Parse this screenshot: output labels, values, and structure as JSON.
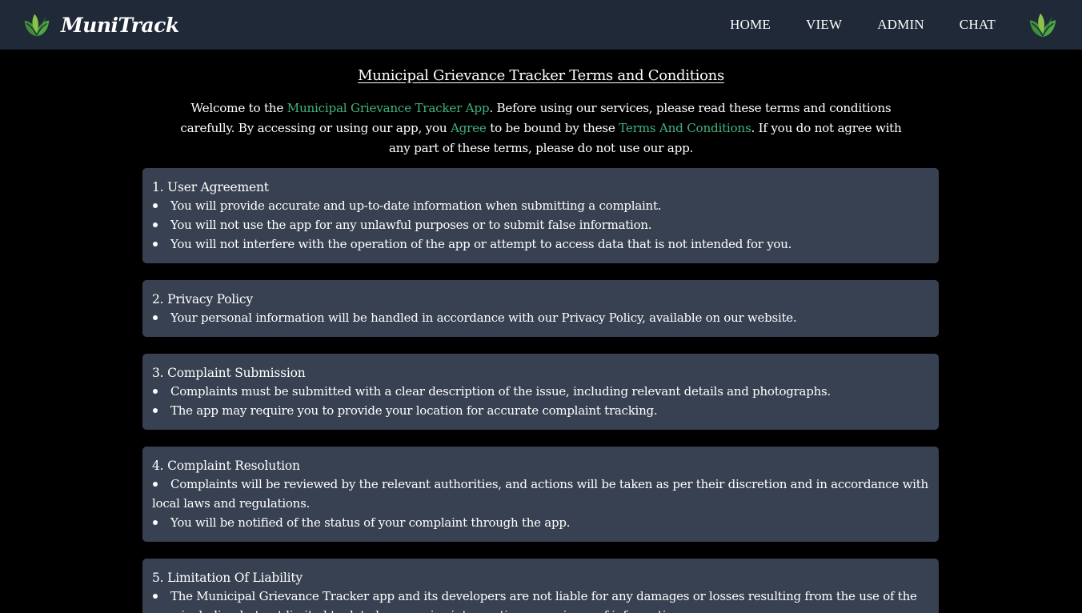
{
  "brand": {
    "name": "MuniTrack"
  },
  "nav": {
    "items": [
      "HOME",
      "VIEW",
      "ADMIN",
      "CHAT"
    ]
  },
  "colors": {
    "navbar_bg": "#1f2937",
    "page_bg": "#000000",
    "card_bg": "#374151",
    "highlight": "#3fb27f"
  },
  "icons": {
    "brand_logo": "leaf-logo-icon",
    "nav_logo": "leaf-logo-icon"
  },
  "page": {
    "title": "Municipal Grievance Tracker Terms and Conditions",
    "intro": {
      "p1": "Welcome to the ",
      "h1": "Municipal Grievance Tracker App",
      "p2": ". Before using our services, please read these terms and conditions carefully. By accessing or using our app, you ",
      "h2": "Agree",
      "p3": " to be bound by these ",
      "h3": "Terms And Conditions",
      "p4": ". If you do not agree with any part of these terms, please do not use our app."
    }
  },
  "sections": [
    {
      "title": "1. User Agreement",
      "items": [
        "You will provide accurate and up-to-date information when submitting a complaint.",
        "You will not use the app for any unlawful purposes or to submit false information.",
        "You will not interfere with the operation of the app or attempt to access data that is not intended for you."
      ]
    },
    {
      "title": "2. Privacy Policy",
      "items": [
        "Your personal information will be handled in accordance with our Privacy Policy, available on our website."
      ]
    },
    {
      "title": "3. Complaint Submission",
      "items": [
        "Complaints must be submitted with a clear description of the issue, including relevant details and photographs.",
        "The app may require you to provide your location for accurate complaint tracking."
      ]
    },
    {
      "title": "4. Complaint Resolution",
      "items": [
        "Complaints will be reviewed by the relevant authorities, and actions will be taken as per their discretion and in accordance with local laws and regulations.",
        "You will be notified of the status of your complaint through the app."
      ]
    },
    {
      "title": "5. Limitation Of Liability",
      "items": [
        "The Municipal Grievance Tracker app and its developers are not liable for any damages or losses resulting from the use of the app, including but not limited to data loss, service interruptions, or misuse of information."
      ]
    }
  ]
}
